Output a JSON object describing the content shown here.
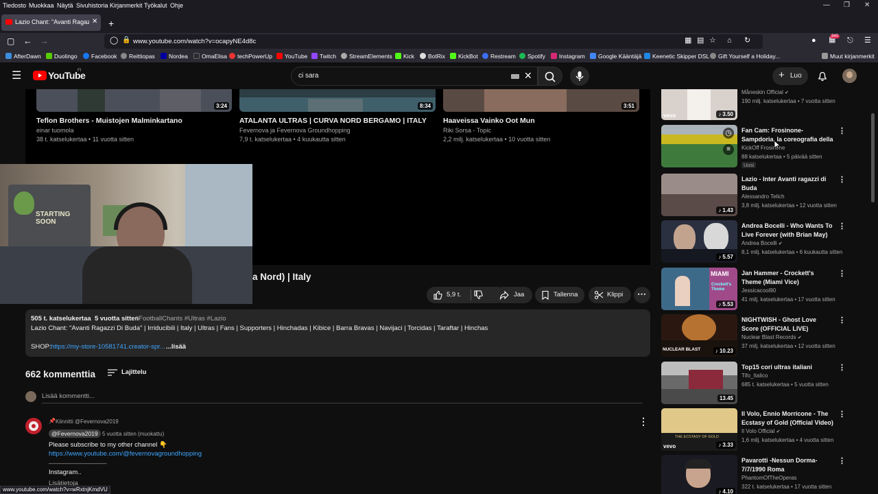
{
  "menubar": {
    "items": [
      "Tiedosto",
      "Muokkaa",
      "Näytä",
      "Sivuhistoria",
      "Kirjanmerkit",
      "Työkalut",
      "Ohje"
    ]
  },
  "browser": {
    "tab_title": "Lazio Chant: \"Avanti Ragazzi Di",
    "url": "www.youtube.com/watch?v=ocapyNE4d8c",
    "extension_badge": "340",
    "status_url": "www.youtube.com/watch?v=wRxtnjKmdVU"
  },
  "bookmarks": {
    "items": [
      "AfterDawn",
      "Duolingo",
      "Facebook",
      "Reittiopas",
      "Nordea",
      "OmaElisa",
      "techPowerUp",
      "YouTube",
      "Twitch",
      "StreamElements",
      "Kick",
      "BotRix",
      "KickBot",
      "Restream",
      "Spotify",
      "Instagram",
      "Google Kääntäjä",
      "Keenetic Skipper DSL",
      "Gift Yourself a Holiday..."
    ],
    "other": "Muut kirjanmerkit"
  },
  "youtube": {
    "logo_text": "YouTube",
    "region": "FI",
    "search_value": "ci sara",
    "create_label": "Luo"
  },
  "end_cards": [
    {
      "title": "Teflon Brothers - Muistojen Malminkartano",
      "channel": "einar tuomola",
      "meta": "38 t. katselukertaa • 11 vuotta sitten",
      "duration": "3:24"
    },
    {
      "title": "ATALANTA ULTRAS | CURVA NORD BERGAMO | ITALY",
      "channel": "Fevernova ja Fevernova Groundhopping",
      "meta": "7,9 t. katselukertaa • 4 kuukautta sitten",
      "duration": "8:34"
    },
    {
      "title": "Haaveissa Vainko Oot Mun",
      "channel": "Riki Sorsa - Topic",
      "meta": "2,2 milj. katselukertaa • 10 vuotta sitten",
      "duration": "3:51"
    }
  ],
  "webcam": {
    "sign_text": "STARTING SOON"
  },
  "video": {
    "title_visible": "a Nord) | Italy",
    "likes": "5,9 t.",
    "share_label": "Jaa",
    "save_label": "Tallenna",
    "clip_label": "Klippi"
  },
  "description": {
    "stats": "505 t. katselukertaa  5 vuotta sitten",
    "hashtags": "#FootballChants #Ultras #Lazio",
    "text": "Lazio Chant: \"Avanti Ragazzi Di Buda\" | Irriducibili | Italy | Ultras | Fans | Supporters | Hinchadas | Kibice | Barra Bravas | Navijaci | Torcidas | Taraftar | Hinchas",
    "shop_label": "SHOP:",
    "shop_link": "https://my-store-10581741.creator-spr...",
    "more": "...lisää"
  },
  "comments": {
    "count_title": "662 kommenttia",
    "sort_label": "Lajittelu",
    "add_placeholder": "Lisää kommentti...",
    "pinned": "Kiinnitti @Fevernova2019",
    "author": "@Fevernova2019",
    "time": "5 vuotta sitten (muokattu)",
    "line1": "Please subscribe to my other channel 👇",
    "link": "https://www.youtube.com/@fevernovagroundhopping",
    "line3": "________________",
    "line4": "Instagram..",
    "more": "Lisätietoja"
  },
  "sidebar": [
    {
      "title": "",
      "channel": "Måneskin Official",
      "meta": "190 milj. katselukertaa • 7 vuotta sitten",
      "duration": "3.50",
      "verified": true,
      "badge": ""
    },
    {
      "title": "Fan Cam: Frosinone-Sampdoria, la coreografia della Curva Nor...",
      "channel": "KickOff Frosinone",
      "meta": "88 katselukertaa • 5 päivää sitten",
      "duration": "",
      "verified": false,
      "badge": "Uusi"
    },
    {
      "title": "Lazio - Inter Avanti ragazzi di Buda",
      "channel": "Alessandro Telich",
      "meta": "3,8 milj. katselukertaa • 12 vuotta sitten",
      "duration": "1.43",
      "verified": false,
      "badge": ""
    },
    {
      "title": "Andrea Bocelli - Who Wants To Live Forever (with Brian May) -...",
      "channel": "Andrea Bocelli",
      "meta": "8,1 milj. katselukertaa • 6 kuukautta sitten",
      "duration": "5.57",
      "verified": true,
      "badge": ""
    },
    {
      "title": "Jan Hammer - Crockett's Theme (Miami Vice)",
      "channel": "Jessicacool90",
      "meta": "41 milj. katselukertaa • 17 vuotta sitten",
      "duration": "5.53",
      "verified": false,
      "badge": ""
    },
    {
      "title": "NIGHTWISH - Ghost Love Score (OFFICIAL LIVE)",
      "channel": "Nuclear Blast Records",
      "meta": "37 milj. katselukertaa • 12 vuotta sitten",
      "duration": "10.23",
      "verified": true,
      "badge": ""
    },
    {
      "title": "Top15 cori ultras italiani",
      "channel": "Tifo_Italico",
      "meta": "685 t. katselukertaa • 5 vuotta sitten",
      "duration": "13.45",
      "verified": false,
      "badge": ""
    },
    {
      "title": "Il Volo, Ennio Morricone - The Ecstasy of Gold (Official Video)",
      "channel": "Il Volo Official",
      "meta": "1,6 milj. katselukertaa • 4 vuotta sitten",
      "duration": "3.33",
      "verified": true,
      "badge": ""
    },
    {
      "title": "Pavarotti -Nessun Dorma- 7/7/1990 Roma",
      "channel": "PhantomOfTheOperas",
      "meta": "322 t. katselukertaa • 17 vuotta sitten",
      "duration": "4.10",
      "verified": false,
      "badge": ""
    }
  ],
  "thumb_texts": {
    "vevo": "vevo",
    "miami": "MIAMI",
    "crockett": "Crockett's Theme",
    "nuclear": "NUCLEAR BLAST",
    "ecstasy": "THE ECSTASY OF GOLD"
  },
  "colors": {
    "accent_red": "#ff0000",
    "link_blue": "#3ea6ff",
    "background": "#0f0f0f"
  }
}
